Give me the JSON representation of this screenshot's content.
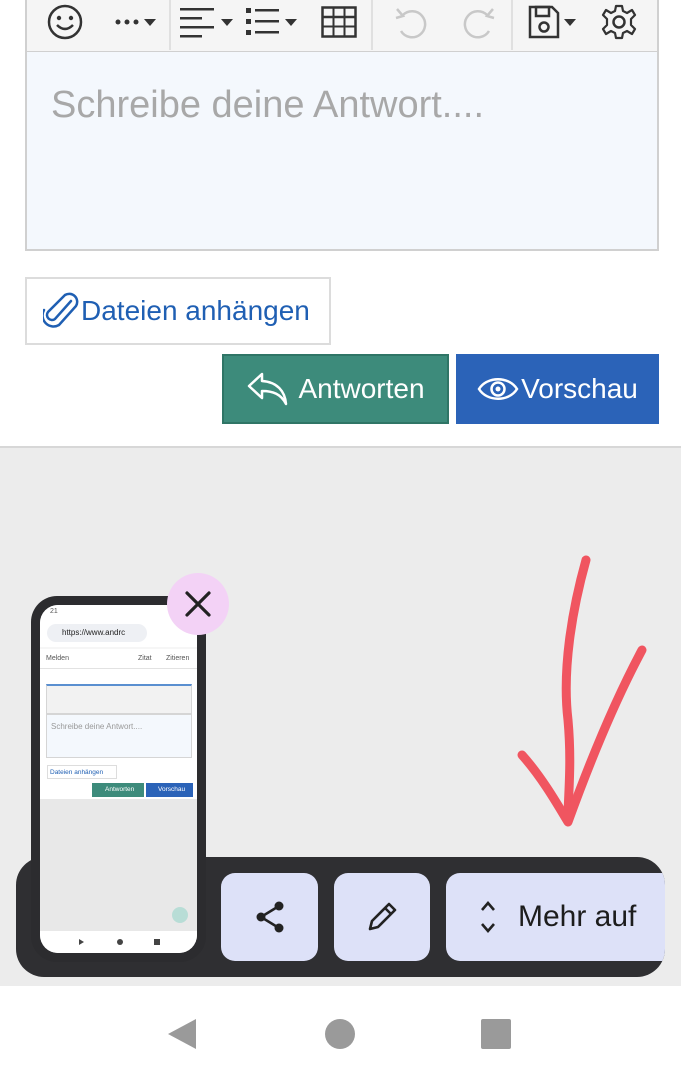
{
  "editor": {
    "toolbar": {
      "items": [
        "emoji",
        "more",
        "align",
        "list",
        "table",
        "undo",
        "redo",
        "save",
        "settings"
      ]
    },
    "placeholder": "Schreibe deine Antwort....",
    "attach_label": "Dateien anhängen",
    "reply_label": "Antworten",
    "preview_label": "Vorschau"
  },
  "thumbnail": {
    "url": "https://www.andrc",
    "melden": "Melden",
    "zitat": "Zitat",
    "zitieren": "Zitieren",
    "placeholder": "Schreibe deine Antwort....",
    "attach_label": "Dateien anhängen",
    "reply_label": "Antworten",
    "preview_label": "Vorschau",
    "time": "21"
  },
  "actions": {
    "more_label": "Mehr auf"
  },
  "colors": {
    "reply": "#3d8b7b",
    "preview": "#2b63b8",
    "link": "#1f5fb3",
    "annotation": "#f05560"
  }
}
